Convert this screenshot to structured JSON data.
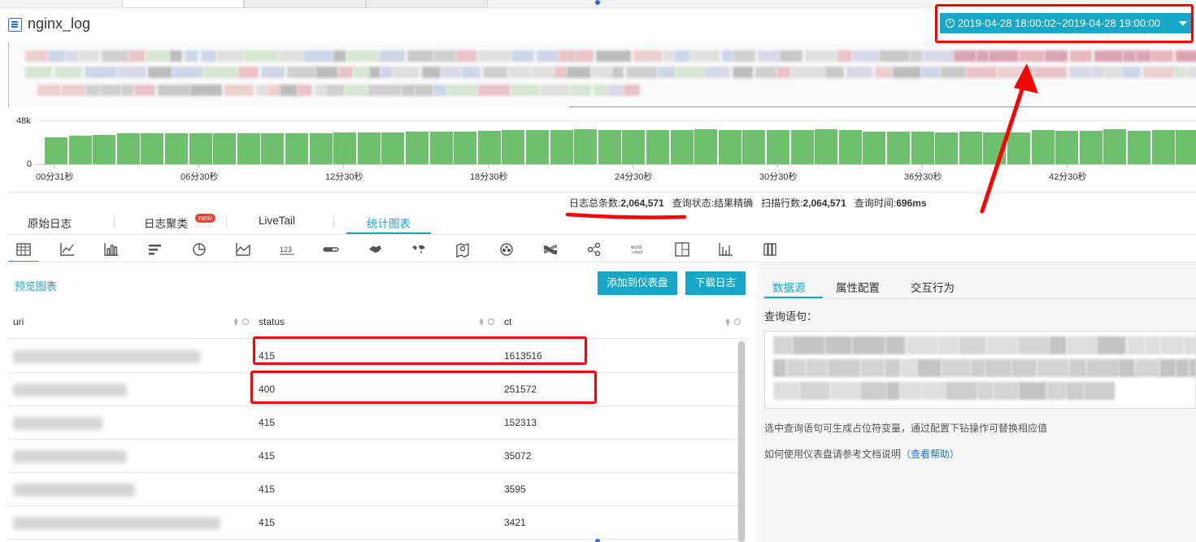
{
  "logstore": {
    "name": "nginx_log"
  },
  "time_range": {
    "label": "2019-04-28 18:00:02~2019-04-28 19:00:00"
  },
  "histogram": {
    "y_max_label": "48k",
    "y_min_label": "0",
    "x_ticks": [
      "00分31秒",
      "06分30秒",
      "12分30秒",
      "18分30秒",
      "24分30秒",
      "30分30秒",
      "36分30秒",
      "42分30秒"
    ],
    "bar_heights": [
      0.62,
      0.65,
      0.67,
      0.7,
      0.7,
      0.7,
      0.71,
      0.7,
      0.7,
      0.7,
      0.71,
      0.71,
      0.72,
      0.73,
      0.73,
      0.74,
      0.75,
      0.75,
      0.76,
      0.78,
      0.77,
      0.78,
      0.8,
      0.78,
      0.78,
      0.77,
      0.78,
      0.8,
      0.77,
      0.78,
      0.78,
      0.77,
      0.8,
      0.78,
      0.75,
      0.75,
      0.75,
      0.73,
      0.75,
      0.73,
      0.72,
      0.77,
      0.76,
      0.76,
      0.8,
      0.76,
      0.78,
      0.78,
      0.8,
      0.77,
      0.77,
      0.78,
      0.79,
      0.8,
      0.83,
      0.79,
      0.78,
      0.8
    ]
  },
  "stats": {
    "total_label": "日志总条数:",
    "total_value": "2,064,571",
    "status_label": "查询状态:",
    "status_value": "结果精确",
    "scanned_label": "扫描行数:",
    "scanned_value": "2,064,571",
    "time_label": "查询时间:",
    "time_value": "696ms"
  },
  "tabs": [
    {
      "label": "原始日志"
    },
    {
      "label": "日志聚类",
      "badge": "new"
    },
    {
      "label": "LiveTail"
    },
    {
      "label": "统计图表"
    }
  ],
  "chart_types": [
    "table-icon",
    "line-chart-icon",
    "bar-chart-icon",
    "horizontal-bar-icon",
    "pie-chart-icon",
    "area-chart-icon",
    "number-icon",
    "progress-bar-icon",
    "china-map-icon",
    "world-map-icon",
    "geo-map-icon",
    "flow-chart-icon",
    "sankey-icon",
    "graph-icon",
    "word-cloud-icon",
    "treemap-icon",
    "column-chart-icon",
    "matrix-icon"
  ],
  "chart_type_labels": {
    "number": "123",
    "word_cloud": "word cloud"
  },
  "preview": {
    "title": "预览图表",
    "add_dashboard": "添加到仪表盘",
    "download": "下载日志"
  },
  "table": {
    "columns": [
      "uri",
      "status",
      "ct"
    ],
    "rows": [
      {
        "status": "415",
        "ct": "1613516"
      },
      {
        "status": "400",
        "ct": "251572"
      },
      {
        "status": "415",
        "ct": "152313"
      },
      {
        "status": "415",
        "ct": "35072"
      },
      {
        "status": "415",
        "ct": "3595"
      },
      {
        "status": "415",
        "ct": "3421"
      }
    ]
  },
  "right_panel": {
    "tabs": [
      "数据源",
      "属性配置",
      "交互行为"
    ],
    "query_label": "查询语句：",
    "note1": "选中查询语句可生成占位符变量，通过配置下钻操作可替换相应值",
    "note2_prefix": "如何使用仪表盘请参考文档说明",
    "note2_link": "（查看帮助）"
  },
  "colors": {
    "accent": "#17a7c9",
    "bar": "#6ec06e",
    "annotation": "#ff0000"
  }
}
